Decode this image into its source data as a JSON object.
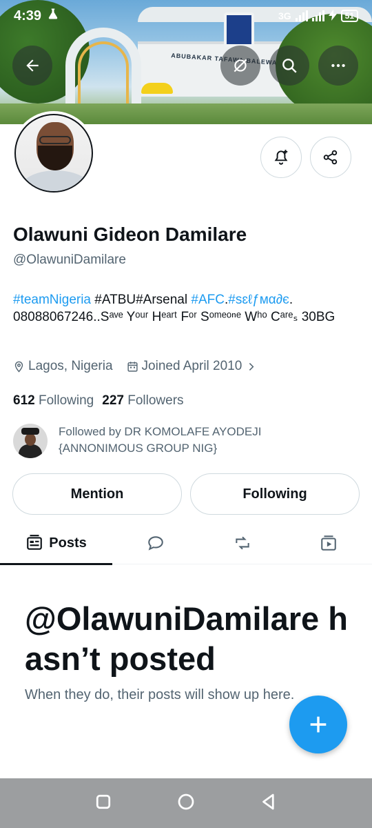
{
  "status_bar": {
    "time": "4:39",
    "network": "3G",
    "battery": "51"
  },
  "banner": {
    "sign_text": "ABUBAKAR TAFAWA BALEWA UNIVERSITY"
  },
  "profile": {
    "name": "Olawuni Gideon Damilare",
    "handle": "@OlawuniDamilare",
    "bio": {
      "tag1": "#teamNigeria",
      "text1": " #ATBU#Arsenal ",
      "tag2": "#AFC",
      "text2": ".",
      "tag3": "#sɛℓƒмα∂є",
      "text3": ". 08088067246..Sᵃᵛᵉ Yᵒᵘʳ Hᵉᵃʳᵗ Fᵒʳ Sᵒᵐᵉᵒⁿᵉ Wʰᵒ Cᵃʳᵉₛ 30BG"
    },
    "location": "Lagos, Nigeria",
    "joined": "Joined April 2010",
    "following_count": "612",
    "following_label": "Following",
    "followers_count": "227",
    "followers_label": "Followers",
    "followed_by": "Followed by DR KOMOLAFE AYODEJI {ANNONIMOUS GROUP NIG}"
  },
  "actions": {
    "mention_label": "Mention",
    "following_label": "Following"
  },
  "tabs": {
    "posts_label": "Posts"
  },
  "empty_state": {
    "title": "@OlawuniDamilare hasn’t posted",
    "subtitle": "When they do, their posts will show up here."
  },
  "colors": {
    "accent": "#1d9bf0",
    "text_primary": "#0f1419",
    "text_secondary": "#536471"
  }
}
